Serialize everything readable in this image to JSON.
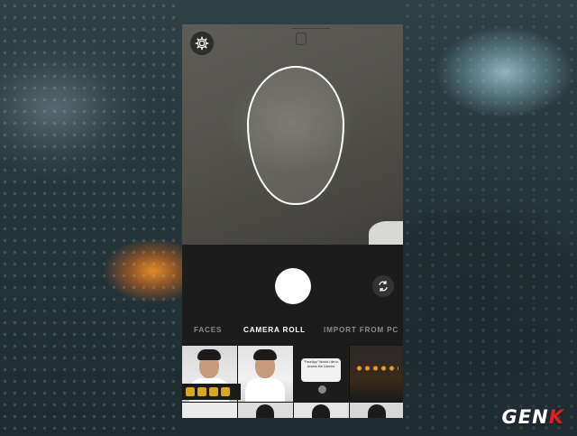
{
  "tabs": [
    {
      "label": "FACES",
      "active": false
    },
    {
      "label": "CAMERA ROLL",
      "active": true
    },
    {
      "label": "IMPORT FROM PC",
      "active": false
    }
  ],
  "icons": {
    "settings": "gear-icon",
    "flip_camera": "camera-flip-icon",
    "shutter": "shutter-button"
  },
  "gallery": {
    "alert_text": "\"FaceApp\" Would Like to Access the Camera"
  },
  "watermark": {
    "text_main": "GEN",
    "text_accent": "K"
  },
  "colors": {
    "accent": "#ffffff",
    "watermark_accent": "#e02020"
  }
}
